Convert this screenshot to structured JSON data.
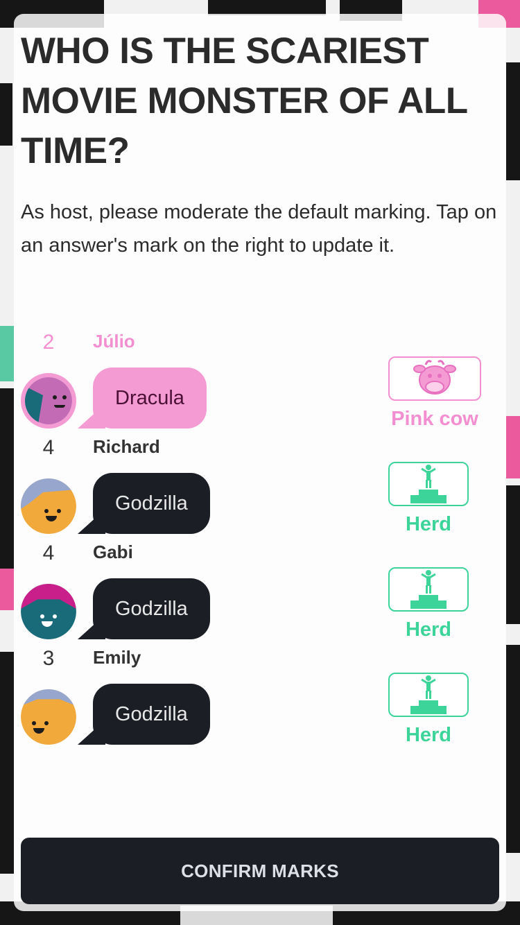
{
  "question": "WHO IS THE SCARIEST MOVIE MONSTER OF ALL TIME?",
  "instructions": "As host, please moderate the default marking. Tap on an answer's mark on the right to update it.",
  "answers": [
    {
      "score": "2",
      "player": "Júlio",
      "answer": "Dracula",
      "mark": "Pink cow",
      "highlight": true
    },
    {
      "score": "4",
      "player": "Richard",
      "answer": "Godzilla",
      "mark": "Herd",
      "highlight": false
    },
    {
      "score": "4",
      "player": "Gabi",
      "answer": "Godzilla",
      "mark": "Herd",
      "highlight": false
    },
    {
      "score": "3",
      "player": "Emily",
      "answer": "Godzilla",
      "mark": "Herd",
      "highlight": false
    }
  ],
  "confirm_label": "CONFIRM MARKS",
  "colors": {
    "pink_cow": "#f38fd0",
    "herd": "#3dd49a",
    "dark": "#1b1e24"
  },
  "icons": [
    "pink-cow-icon",
    "herd-podium-icon"
  ]
}
